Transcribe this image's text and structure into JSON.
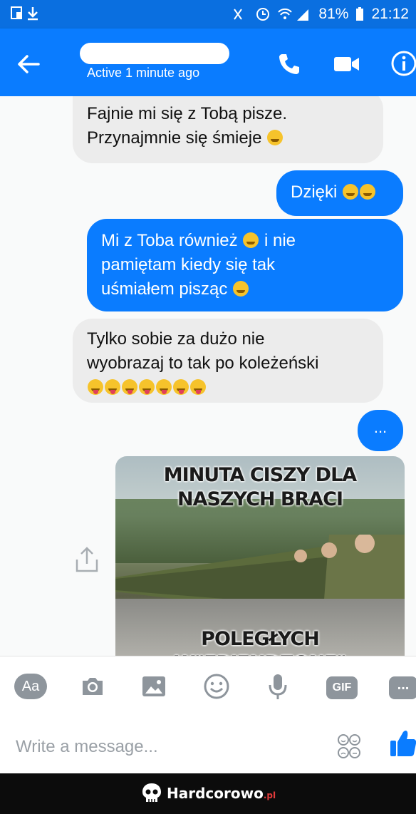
{
  "status_bar": {
    "battery": "81%",
    "time": "21:12"
  },
  "header": {
    "active_status": "Active 1 minute ago",
    "icons": [
      "back-arrow-icon",
      "phone-icon",
      "video-camera-icon",
      "info-icon"
    ],
    "accent_color": "#0a7cff"
  },
  "messages": [
    {
      "direction": "incoming",
      "text": "Fajnie mi się z Tobą pisze.\nPrzynajmnie się śmieje",
      "emoji": [
        "grinning-face"
      ]
    },
    {
      "direction": "outgoing",
      "text": "Dzięki",
      "emoji": [
        "smiling-face",
        "smiling-face"
      ]
    },
    {
      "direction": "outgoing",
      "text_parts": [
        "Mi z Toba również",
        "i nie\npamiętam kiedy się tak\nuśmiałem pisząc"
      ],
      "emoji": [
        "slightly-smiling-face",
        "slightly-smiling-face"
      ]
    },
    {
      "direction": "incoming",
      "text": "Tylko sobie za dużo nie\nwyobrazaj  to tak po koleżeński",
      "emoji": [
        "tongue-face",
        "tongue-face",
        "tongue-face",
        "tongue-face",
        "tongue-face",
        "tongue-face",
        "tongue-face"
      ]
    },
    {
      "direction": "outgoing",
      "text": "..."
    }
  ],
  "meme": {
    "top_text": "MINUTA CISZY DLA\nNASZYCH BRACI",
    "bottom_text": "POLEGŁYCH W\"FRIENDZONE\""
  },
  "composer": {
    "aa_label": "Aa",
    "gif_label": "GIF",
    "more_label": "...",
    "placeholder": "Write a message...",
    "icons": [
      "camera-icon",
      "image-icon",
      "emoji-icon",
      "microphone-icon",
      "sticker-icon",
      "thumbs-up-icon"
    ]
  },
  "watermark": {
    "text": "Hardcorowo",
    "suffix": ".pl"
  }
}
